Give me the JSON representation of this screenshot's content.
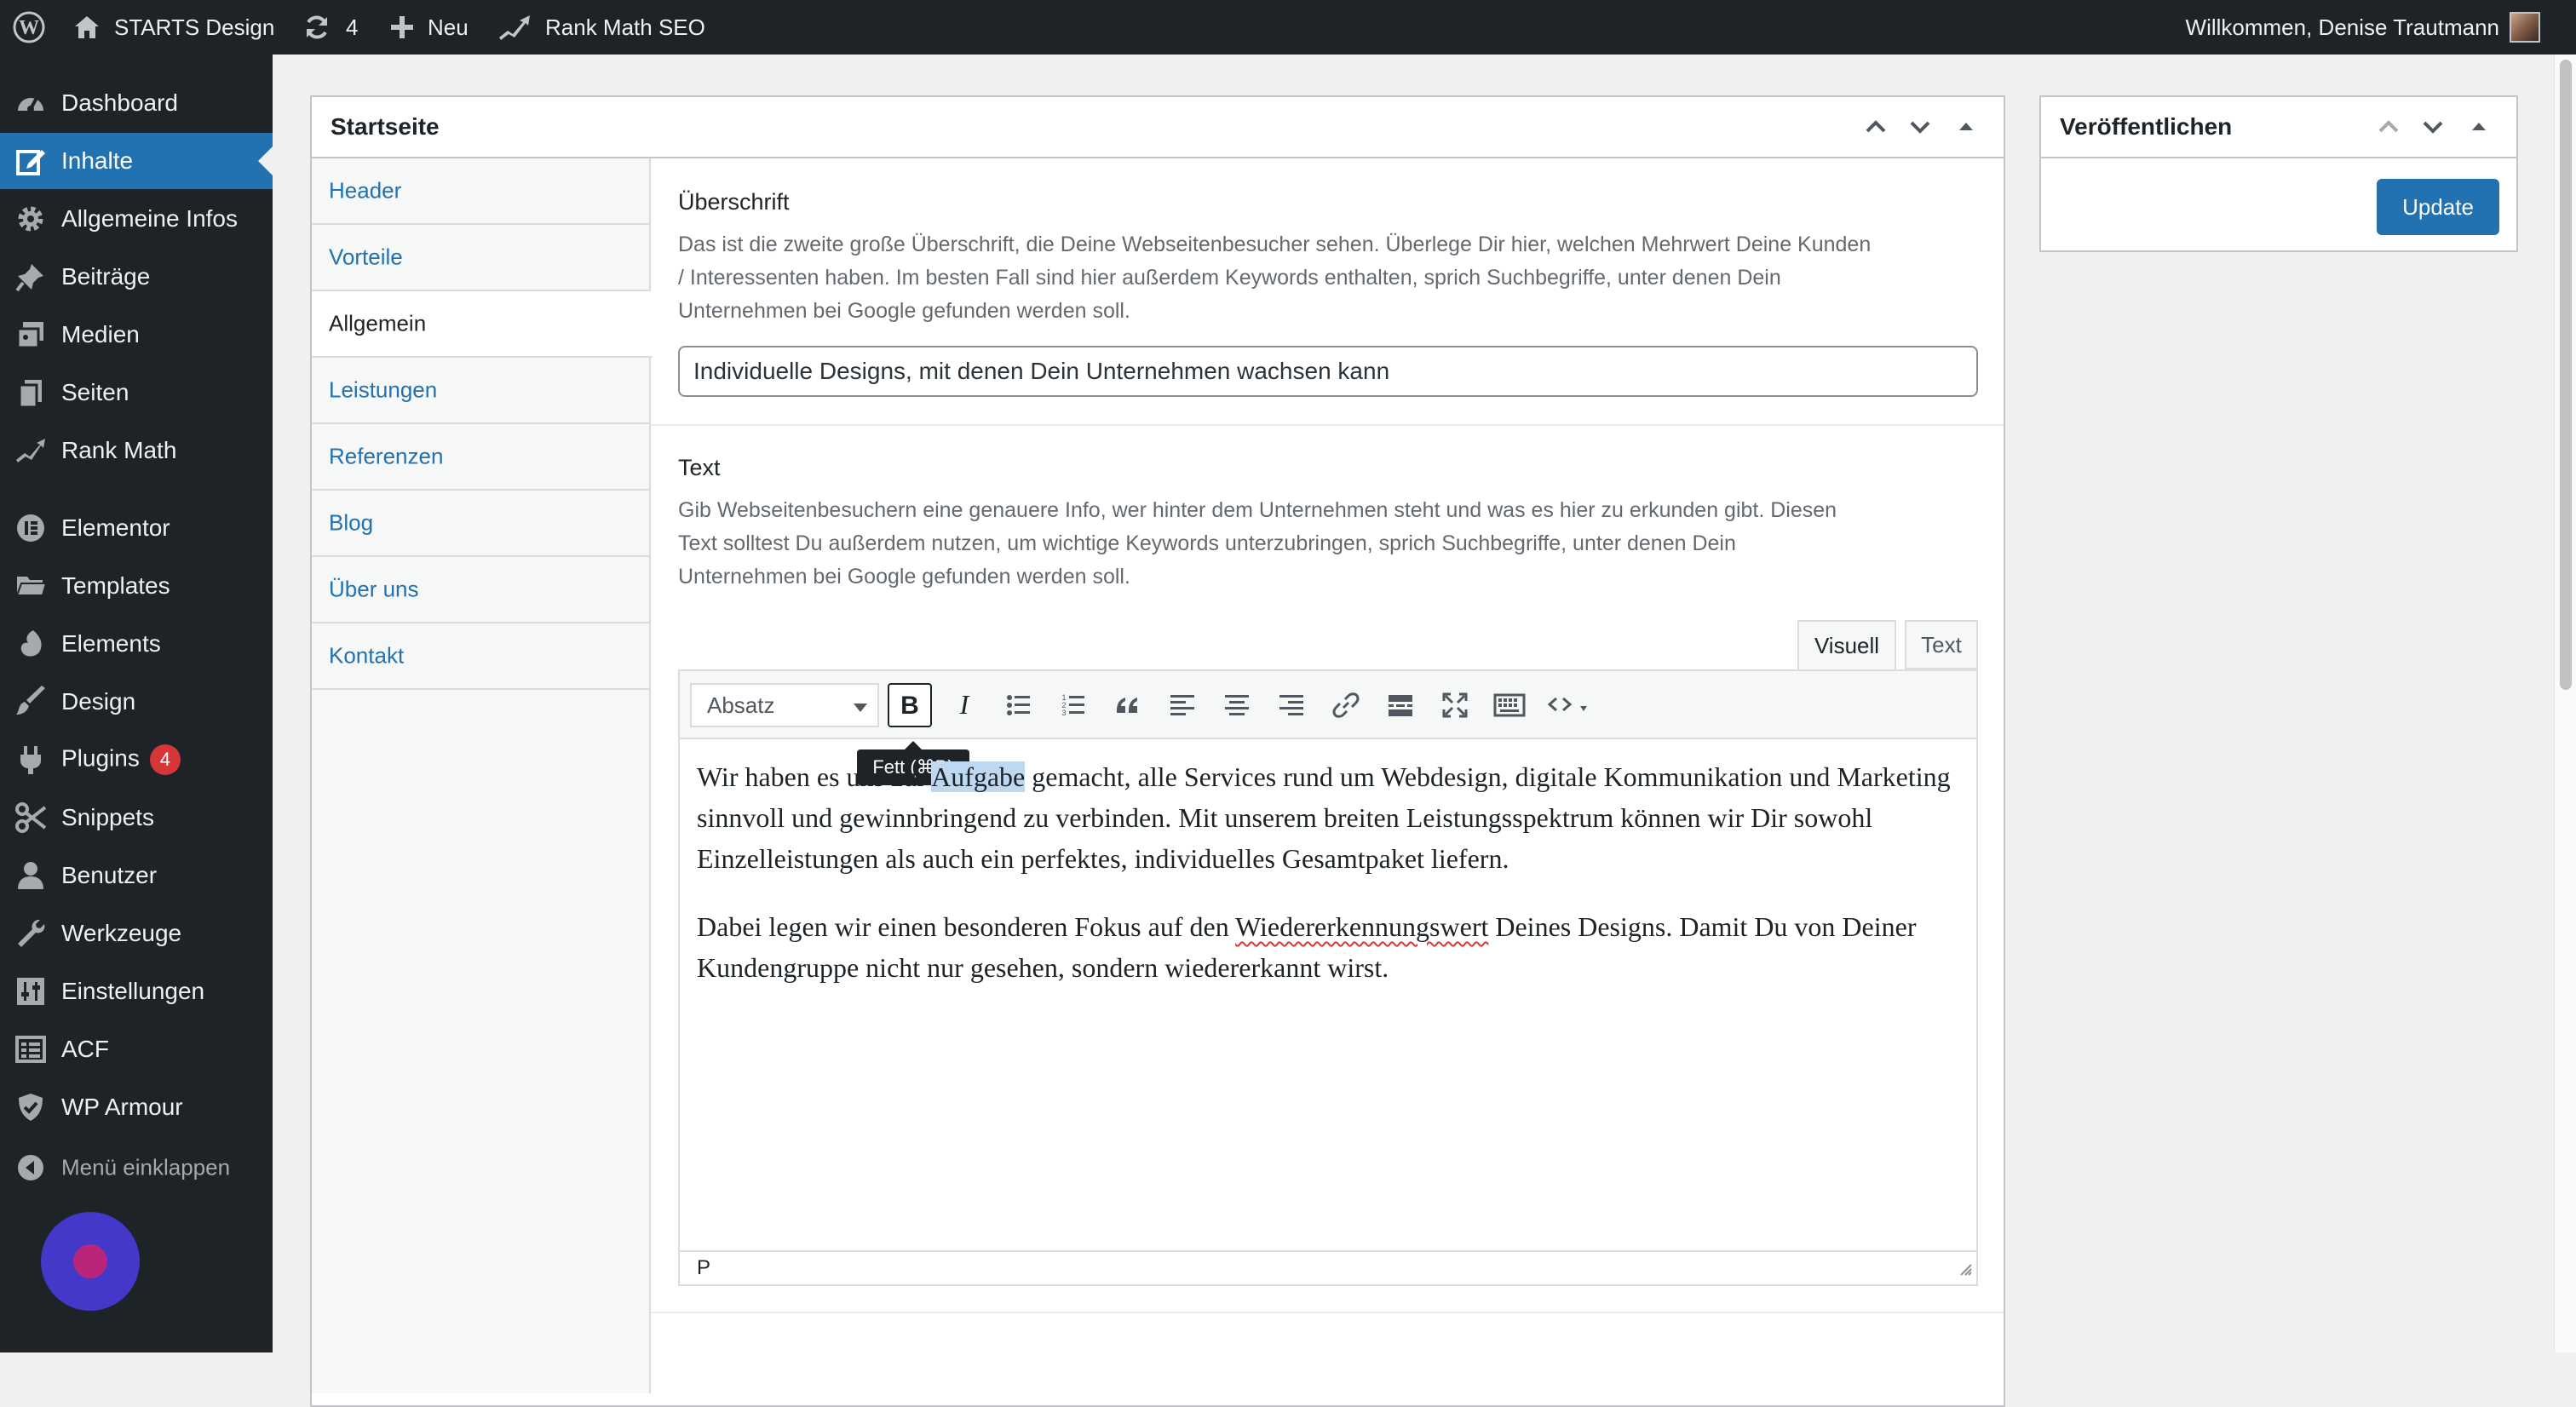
{
  "admin_bar": {
    "site_name": "STARTS Design",
    "updates_count": "4",
    "new_label": "Neu",
    "seo_label": "Rank Math SEO",
    "greeting": "Willkommen, Denise Trautmann"
  },
  "sidebar": {
    "items": [
      {
        "label": "Dashboard",
        "icon": "dashboard-icon"
      },
      {
        "label": "Inhalte",
        "icon": "edit-icon"
      },
      {
        "label": "Allgemeine Infos",
        "icon": "gear-icon"
      },
      {
        "label": "Beiträge",
        "icon": "pin-icon"
      },
      {
        "label": "Medien",
        "icon": "media-icon"
      },
      {
        "label": "Seiten",
        "icon": "pages-icon"
      },
      {
        "label": "Rank Math",
        "icon": "rank-math-icon"
      },
      {
        "label": "Elementor",
        "icon": "elementor-icon"
      },
      {
        "label": "Templates",
        "icon": "folder-icon"
      },
      {
        "label": "Elements",
        "icon": "elements-icon"
      },
      {
        "label": "Design",
        "icon": "brush-icon"
      },
      {
        "label": "Plugins",
        "icon": "plugin-icon",
        "badge": "4"
      },
      {
        "label": "Snippets",
        "icon": "scissors-icon"
      },
      {
        "label": "Benutzer",
        "icon": "user-icon"
      },
      {
        "label": "Werkzeuge",
        "icon": "wrench-icon"
      },
      {
        "label": "Einstellungen",
        "icon": "settings-icon"
      },
      {
        "label": "ACF",
        "icon": "acf-icon"
      },
      {
        "label": "WP Armour",
        "icon": "shield-icon"
      }
    ],
    "collapse_label": "Menü einklappen"
  },
  "main_box": {
    "title": "Startseite",
    "tabs": [
      "Header",
      "Vorteile",
      "Allgemein",
      "Leistungen",
      "Referenzen",
      "Blog",
      "Über uns",
      "Kontakt"
    ],
    "active_tab": "Allgemein",
    "heading_field": {
      "label": "Überschrift",
      "description_lines": [
        "Das ist die zweite große Überschrift, die Deine Webseitenbesucher sehen. Überlege Dir hier, welchen Mehrwert Deine Kunden",
        "/ Interessenten haben. Im besten Fall sind hier außerdem Keywords enthalten, sprich Suchbegriffe, unter denen Dein",
        "Unternehmen bei Google gefunden werden soll."
      ],
      "value": "Individuelle Designs, mit denen Dein Unternehmen wachsen kann"
    },
    "text_field": {
      "label": "Text",
      "description_lines": [
        "Gib Webseitenbesuchern eine genauere Info, wer hinter dem Unternehmen steht und was es hier zu erkunden gibt. Diesen",
        "Text solltest Du außerdem nutzen, um wichtige Keywords unterzubringen, sprich Suchbegriffe, unter denen Dein",
        "Unternehmen bei Google gefunden werden soll."
      ],
      "editor_tabs": {
        "visual": "Visuell",
        "text": "Text"
      },
      "format_select": "Absatz",
      "tooltip": "Fett (⌘B)",
      "toolbar_icons": [
        "bold-icon",
        "italic-icon",
        "bullet-list-icon",
        "numbered-list-icon",
        "blockquote-icon",
        "align-left-icon",
        "align-center-icon",
        "align-right-icon",
        "link-icon",
        "read-more-icon",
        "fullscreen-icon",
        "toolbar-toggle-icon",
        "code-icon"
      ],
      "paragraph1": {
        "before": "Wir haben es uns zur ",
        "selected": "Aufgabe",
        "after": " gemacht, alle Services rund um Webdesign, digitale Kommunikation und Marketing sinnvoll und gewinnbringend zu verbinden. Mit unserem breiten Leistungsspektrum können wir Dir sowohl Einzelleistungen als auch ein perfektes, individuelles Gesamtpaket liefern."
      },
      "paragraph2": {
        "before": "Dabei legen wir einen besonderen Fokus auf den ",
        "misspelled": "Wiedererkennungswert",
        "after": " Deines Designs. Damit Du von Deiner Kundengruppe nicht nur gesehen, sondern wiedererkannt wirst."
      },
      "status_path": "P"
    }
  },
  "publish_box": {
    "title": "Veröffentlichen",
    "update_label": "Update"
  },
  "colors": {
    "admin_dark": "#1d2327",
    "accent_blue": "#2271b1",
    "badge_red": "#d63638",
    "chat_bubble": "#4338ca"
  }
}
